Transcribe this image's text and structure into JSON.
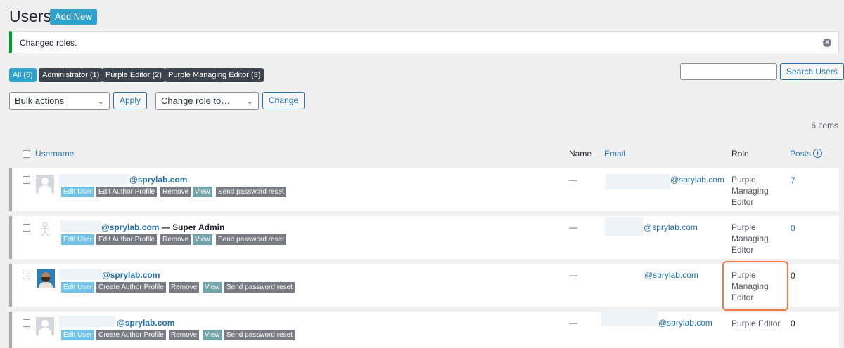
{
  "page": {
    "title": "Users",
    "add_new": "Add New"
  },
  "notice": {
    "text": "Changed roles.",
    "dismiss": "×"
  },
  "filters": [
    {
      "label": "All (6)",
      "active": true
    },
    {
      "label": "Administrator (1)"
    },
    {
      "label": "Purple Editor (2)"
    },
    {
      "label": "Purple Managing Editor (3)"
    }
  ],
  "search": {
    "button": "Search Users",
    "value": ""
  },
  "bulk": {
    "selected": "Bulk actions",
    "apply": "Apply"
  },
  "change_role": {
    "selected": "Change role to…",
    "button": "Change"
  },
  "items_count": "6 items",
  "columns": {
    "username": "Username",
    "name": "Name",
    "email": "Email",
    "role": "Role",
    "posts": "Posts"
  },
  "icons": {
    "avatar": "default-avatar-icon",
    "photo": "user-photo-avatar",
    "info": "info-icon",
    "dismiss": "dismiss-icon",
    "chevron": "chevron-down-icon"
  },
  "colors": {
    "accent": "#2271b1",
    "success": "#00a32a",
    "highlight": "#ee7a48"
  },
  "rows": [
    {
      "username": "@sprylab.com",
      "super": "",
      "actions": [
        "Edit User",
        "Edit Author Profile",
        "Remove",
        "View",
        "Send password reset"
      ],
      "name": "—",
      "email": "@sprylab.com",
      "role": "Purple Managing Editor",
      "posts": "7"
    },
    {
      "username": "@sprylab.com",
      "super": " — Super Admin",
      "actions": [
        "Edit User",
        "Edit Author Profile",
        "Remove",
        "View",
        "Send password reset"
      ],
      "name": "—",
      "email": "@sprylab.com",
      "role": "Purple Managing Editor",
      "posts": "0"
    },
    {
      "username": "@sprylab.com",
      "super": "",
      "actions": [
        "Edit User",
        "Create Author Profile",
        "Remove",
        "View",
        "Send password reset"
      ],
      "name": "—",
      "email": "@sprylab.com",
      "role": "Purple Managing Editor",
      "posts": "0"
    },
    {
      "username": "@sprylab.com",
      "super": "",
      "actions": [
        "Edit User",
        "Create Author Profile",
        "Remove",
        "View",
        "Send password reset"
      ],
      "name": "—",
      "email": "@sprylab.com",
      "role": "Purple Editor",
      "posts": "0"
    }
  ]
}
